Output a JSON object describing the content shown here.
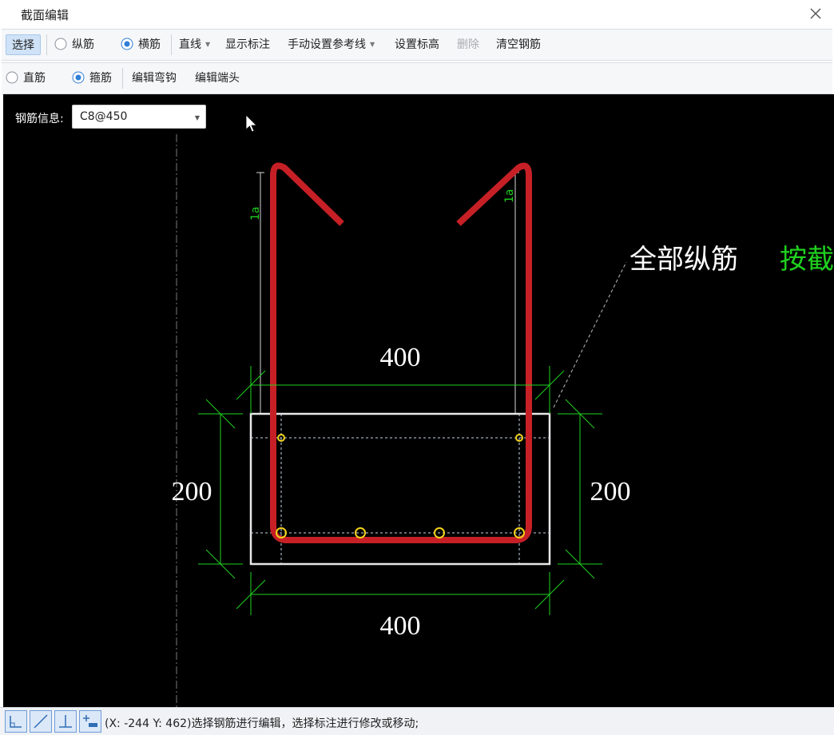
{
  "window": {
    "title": "截面编辑"
  },
  "toolbar1": {
    "select": "选择",
    "longitudinal": "纵筋",
    "transverse": "横筋",
    "line": "直线",
    "show_dims": "显示标注",
    "manual_ref": "手动设置参考线",
    "set_elevation": "设置标高",
    "delete": "删除",
    "clear_rebar": "清空钢筋"
  },
  "toolbar2": {
    "straight": "直筋",
    "stirrup": "箍筋",
    "edit_hook": "编辑弯钩",
    "edit_end": "编辑端头"
  },
  "canvas": {
    "rebar_info_label": "钢筋信息:",
    "rebar_info_value": "C8@450",
    "dim_top": "400",
    "dim_bottom": "400",
    "dim_left": "200",
    "dim_right": "200",
    "anchor_left": "1a",
    "anchor_right": "1a",
    "annotation_white": "全部纵筋",
    "annotation_green": "按截",
    "colors": {
      "rebar": "#c62026",
      "dimension": "#1fd21f",
      "section": "#e8e8e8",
      "longitudinal_bar": "#f2d21b"
    }
  },
  "status": {
    "coords": "(X: -244 Y: 462)",
    "message": "选择钢筋进行编辑，选择标注进行修改或移动;"
  }
}
